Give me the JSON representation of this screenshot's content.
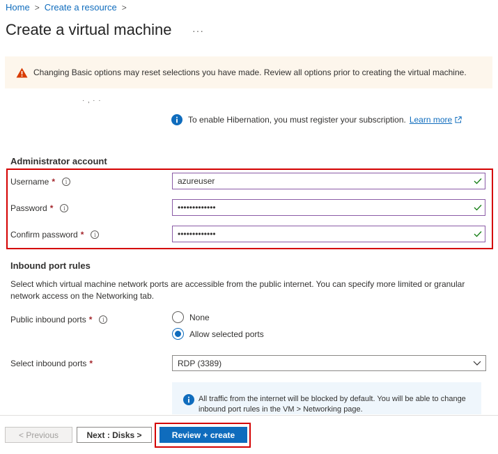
{
  "breadcrumb": {
    "home": "Home",
    "create_resource": "Create a resource",
    "separator": ">"
  },
  "page": {
    "title": "Create a virtual machine",
    "more": "···"
  },
  "warning": {
    "text": "Changing Basic options may reset selections you have made. Review all options prior to creating the virtual machine."
  },
  "clipped_text": "·   ‚ ·   ·",
  "hibernation": {
    "text": "To enable Hibernation, you must register your subscription.",
    "link": "Learn more"
  },
  "admin": {
    "heading": "Administrator account",
    "username_label": "Username",
    "username_value": "azureuser",
    "password_label": "Password",
    "password_value": "•••••••••••••",
    "confirm_label": "Confirm password",
    "confirm_value": "•••••••••••••",
    "required_mark": "*"
  },
  "inbound": {
    "heading": "Inbound port rules",
    "description": "Select which virtual machine network ports are accessible from the public internet. You can specify more limited or granular network access on the Networking tab.",
    "public_ports_label": "Public inbound ports",
    "option_none": "None",
    "option_allow": "Allow selected ports",
    "select_label": "Select inbound ports",
    "select_value": "RDP (3389)",
    "info_text": "All traffic from the internet will be blocked by default. You will be able to change inbound port rules in the VM > Networking page."
  },
  "footer": {
    "previous": "< Previous",
    "next": "Next : Disks >",
    "review": "Review + create"
  },
  "colors": {
    "accent": "#0f6cbd",
    "highlight": "#d40000",
    "success": "#107c10",
    "warning": "#d83b01"
  }
}
